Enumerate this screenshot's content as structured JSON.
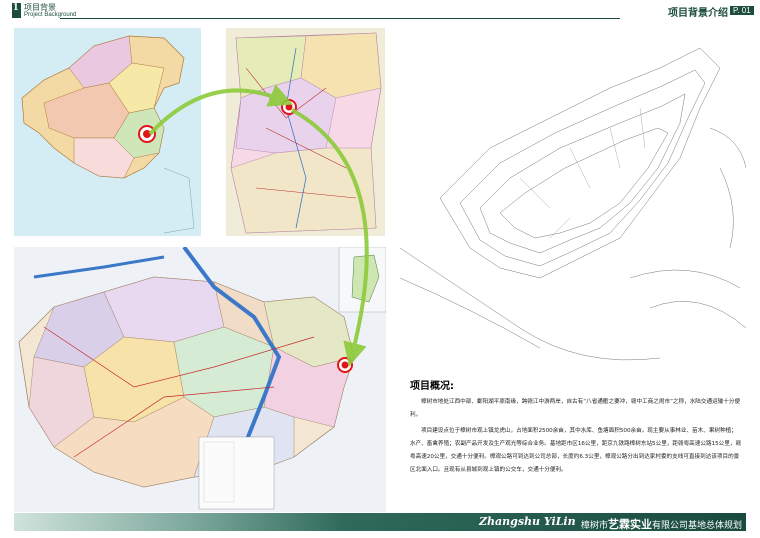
{
  "header": {
    "logo_number": "1",
    "section_cn": "项目背景",
    "section_en": "Project Background",
    "title": "项目背景介绍",
    "page": "P. 01"
  },
  "text": {
    "heading": "项目概况:",
    "paragraphs": [
      "樟树市地处江西中部、鄱阳湖平原南缘，跨赣江中游两岸，自古有“八省通衢之要冲，赣中工商之闹市”之称，水陆交通运输十分便利。",
      "项目建设点位于樟树市观上镇龙虎山，占地面积2500余亩，其中水库、鱼塘面积500余亩。现主要从事林业、苗木、果树种植；水产、畜禽养殖；农副产品开发及生产观光等综合业务。基地距市区16公里，距京九铁路樟树东站5公里，距赣粤高速公路15公里，赣粤高速20公里，交通十分便利。樟观公路可到达到公司总部，长度约6.3公里，樟观公路分出到达家村委的支线可直接到达该项目的景区北面入口。且现有从县城到观上镇的公交车，交通十分便利。"
    ]
  },
  "footer": {
    "en": "Zhangshu YiLin",
    "city": "樟树市",
    "brand": "艺霖实业",
    "rest": "有限公司基地总体规划"
  },
  "colors": {
    "accent": "#1d4d3f",
    "marker": "#e0161b",
    "arrow": "#8dcb3a"
  }
}
